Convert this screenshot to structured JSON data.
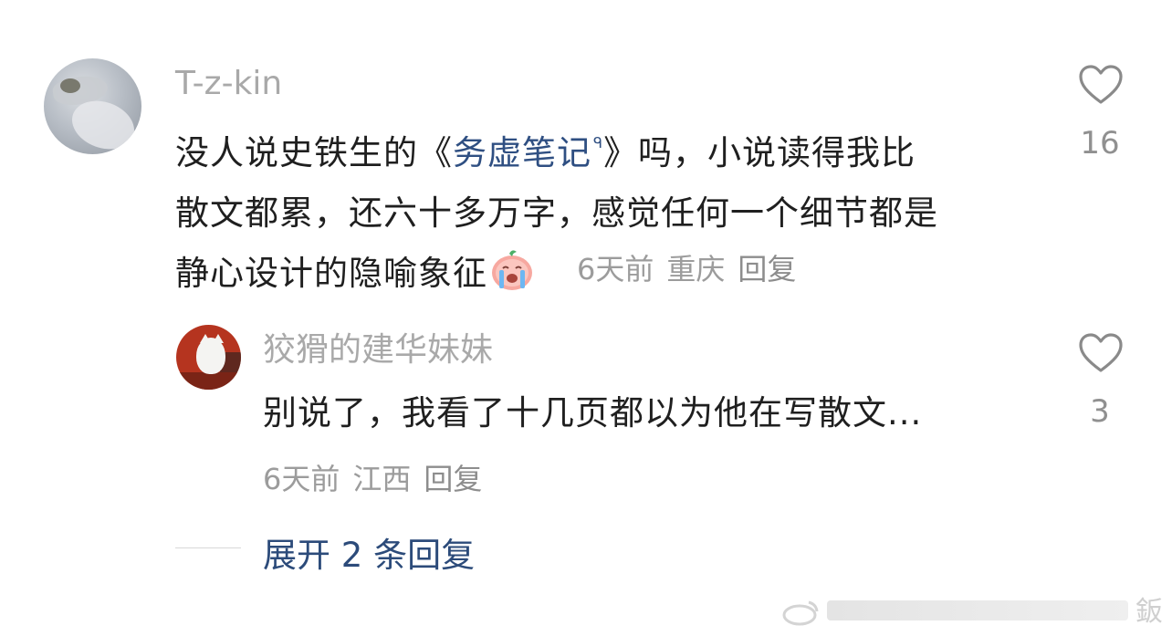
{
  "main_comment": {
    "username": "T-z-kin",
    "text_before_link": "没人说史铁生的《",
    "link_text": "务虚笔记",
    "link_glyph": "ᑫ",
    "text_after_link": "》吗，小说读得我比",
    "line2": "散文都累，还六十多万字，感觉任何一个细节都是",
    "line3": "静心设计的隐喻象征",
    "emoji_name": "crying-face-emoji",
    "time": "6天前",
    "location": "重庆",
    "reply_label": "回复",
    "like_count": "16",
    "icon": "heart-icon"
  },
  "sub_reply": {
    "username": "狡猾的建华妹妹",
    "text": "别说了，我看了十几页都以为他在写散文...",
    "time": "6天前",
    "location": "江西",
    "reply_label": "回复",
    "like_count": "3",
    "icon": "heart-icon"
  },
  "expand": {
    "label": "展开 2 条回复"
  },
  "watermark": {
    "text": "鈑"
  },
  "colors": {
    "link": "#2f4f82",
    "expand": "#2c4b7a",
    "muted": "#a9a9a9"
  }
}
